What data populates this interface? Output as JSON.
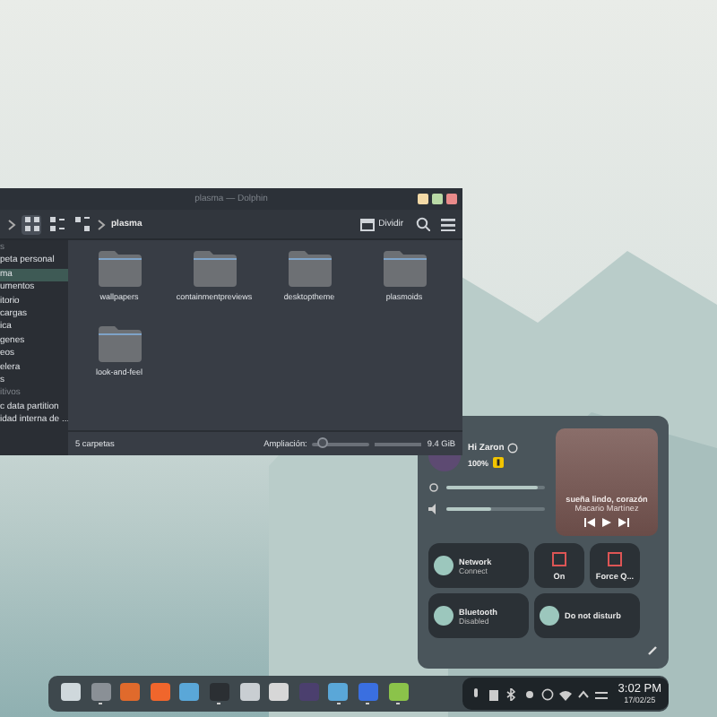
{
  "dolphin": {
    "title": "plasma — Dolphin",
    "breadcrumb": "plasma",
    "split_label": "Dividir",
    "sidebar": [
      {
        "kind": "header",
        "label": "s",
        "selected": false
      },
      {
        "kind": "item",
        "label": "peta personal",
        "selected": false
      },
      {
        "kind": "item",
        "label": "ma",
        "selected": true
      },
      {
        "kind": "item",
        "label": "umentos",
        "selected": false
      },
      {
        "kind": "item",
        "label": "itorio",
        "selected": false
      },
      {
        "kind": "item",
        "label": "cargas",
        "selected": false
      },
      {
        "kind": "item",
        "label": "ica",
        "selected": false
      },
      {
        "kind": "item",
        "label": "genes",
        "selected": false
      },
      {
        "kind": "item",
        "label": "eos",
        "selected": false
      },
      {
        "kind": "item",
        "label": "elera",
        "selected": false
      },
      {
        "kind": "item",
        "label": "s",
        "selected": false
      },
      {
        "kind": "header",
        "label": "itivos",
        "selected": false
      },
      {
        "kind": "item",
        "label": "c data partition",
        "selected": false
      },
      {
        "kind": "item",
        "label": "idad interna de ...",
        "selected": false
      }
    ],
    "folders": [
      "wallpapers",
      "containmentpreviews",
      "desktoptheme",
      "plasmoids",
      "look-and-feel"
    ],
    "status": "5 carpetas",
    "zoom_label": "Ampliación:",
    "zoom": {
      "level": 0.18
    },
    "free_space": "9.4 GiB"
  },
  "control_center": {
    "greeting": "Hi Zaron",
    "battery": "100%",
    "media": {
      "title": "sueña lindo, corazón",
      "artist": "Macario Martínez"
    },
    "brightness": {
      "level": 0.92
    },
    "volume": {
      "level": 0.45
    },
    "toggles": [
      {
        "kind": "wide",
        "title": "Network",
        "subtitle": "Connect",
        "on": true
      },
      {
        "kind": "small",
        "title": "On"
      },
      {
        "kind": "small",
        "title": "Force Q..."
      },
      {
        "kind": "wide",
        "title": "Bluetooth",
        "subtitle": "Disabled",
        "on": true
      },
      {
        "kind": "wide",
        "title": "Do not disturb",
        "on": true
      }
    ]
  },
  "taskbar": {
    "apps": [
      {
        "kind": "launcher",
        "running": false
      },
      {
        "kind": "files",
        "running": true
      },
      {
        "kind": "fox",
        "running": false
      },
      {
        "kind": "store",
        "running": false
      },
      {
        "kind": "image",
        "running": false
      },
      {
        "kind": "terminal",
        "running": true
      },
      {
        "kind": "target",
        "running": false
      },
      {
        "kind": "editor",
        "running": false
      },
      {
        "kind": "diamond",
        "running": false
      },
      {
        "kind": "image",
        "running": true
      },
      {
        "kind": "bird",
        "running": true
      },
      {
        "kind": "notes",
        "running": true
      }
    ],
    "time": "3:02 PM",
    "date": "17/02/25"
  }
}
